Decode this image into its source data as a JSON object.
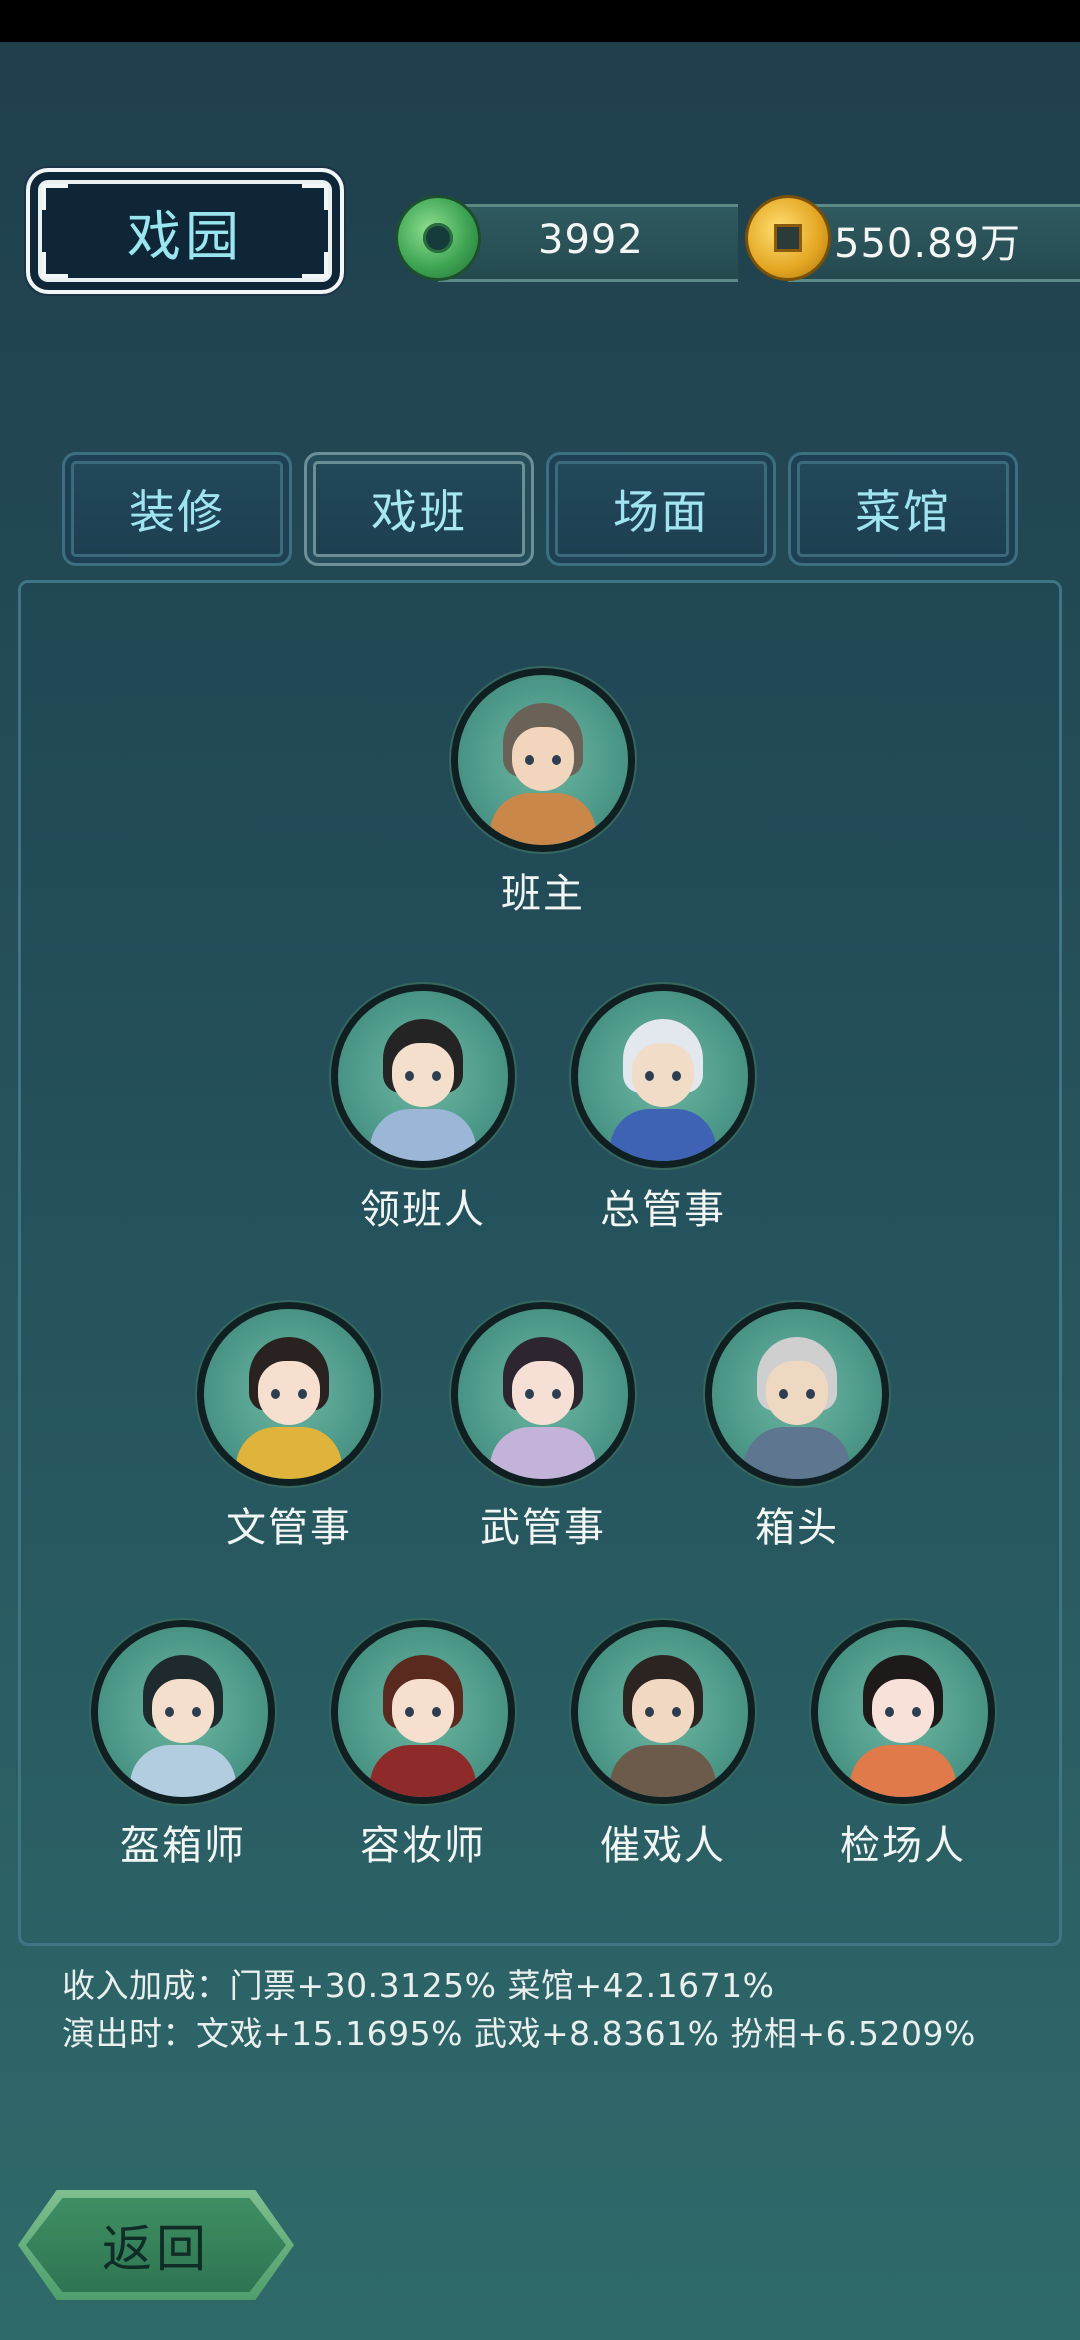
{
  "header": {
    "title": "戏园"
  },
  "currency": {
    "jade": {
      "icon": "jade-disc-icon",
      "value": "3992"
    },
    "coins": {
      "icon": "copper-coin-icon",
      "value": "550.89万"
    }
  },
  "tabs": [
    {
      "label": "装修",
      "active": false
    },
    {
      "label": "戏班",
      "active": true
    },
    {
      "label": "场面",
      "active": false
    },
    {
      "label": "菜馆",
      "active": false
    }
  ],
  "troupe": {
    "row1": [
      {
        "name": "班主",
        "hair": "#6b6257",
        "robe": "#c9874a",
        "face": "#f1d6bd"
      }
    ],
    "row2": [
      {
        "name": "领班人",
        "hair": "#242424",
        "robe": "#9bb6d6",
        "face": "#f4dfcc"
      },
      {
        "name": "总管事",
        "hair": "#e3e8ee",
        "robe": "#3e63b5",
        "face": "#f1dcc8"
      }
    ],
    "row3": [
      {
        "name": "文管事",
        "hair": "#2a2220",
        "robe": "#e0b43a",
        "face": "#f6dfcf"
      },
      {
        "name": "武管事",
        "hair": "#2d2630",
        "robe": "#c3b3d8",
        "face": "#f6e0d6"
      },
      {
        "name": "箱头",
        "hair": "#cfcfcf",
        "robe": "#5e7690",
        "face": "#efd8c2"
      }
    ],
    "row4": [
      {
        "name": "盔箱师",
        "hair": "#1f2a2e",
        "robe": "#b3cde0",
        "face": "#f4dfcd"
      },
      {
        "name": "容妆师",
        "hair": "#5a2a1e",
        "robe": "#8f2a2a",
        "face": "#f6dfcf"
      },
      {
        "name": "催戏人",
        "hair": "#2c2420",
        "robe": "#6c5a4a",
        "face": "#f1d8c3"
      },
      {
        "name": "检场人",
        "hair": "#1e1a1a",
        "robe": "#e07a4a",
        "face": "#f7e1d8"
      }
    ]
  },
  "bonus": {
    "line1": "收入加成：门票+30.3125% 菜馆+42.1671%",
    "line2": "演出时：文戏+15.1695% 武戏+8.8361% 扮相+6.5209%"
  },
  "back_button": {
    "label": "返回"
  }
}
